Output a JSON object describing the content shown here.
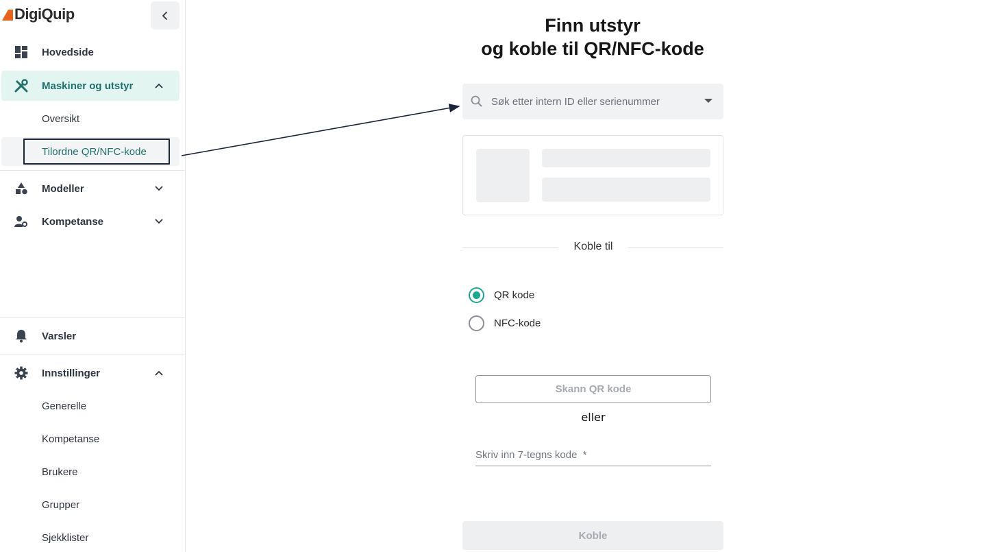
{
  "app": {
    "name": "DigiQuip",
    "brand_color": "#e8641e",
    "accent": "#1aa893"
  },
  "sidebar": {
    "collapse_icon": "chevron-left-icon",
    "nav": [
      {
        "label": "Hovedside",
        "icon": "dashboard-icon"
      },
      {
        "label": "Maskiner og utstyr",
        "icon": "tools-icon",
        "expanded": true,
        "children": [
          "Oversikt",
          "Tilordne QR/NFC-kode"
        ],
        "selected_child": "Tilordne QR/NFC-kode"
      },
      {
        "label": "Modeller",
        "icon": "shapes-icon",
        "expanded": false
      },
      {
        "label": "Kompetanse",
        "icon": "user-gear-icon",
        "expanded": false
      }
    ],
    "bottom": [
      {
        "label": "Varsler",
        "icon": "bell-icon"
      },
      {
        "label": "Innstillinger",
        "icon": "gear-icon",
        "expanded": true,
        "children": [
          "Generelle",
          "Kompetanse",
          "Brukere",
          "Grupper",
          "Sjekklister"
        ]
      }
    ]
  },
  "main": {
    "title_line1": "Finn utstyr",
    "title_line2": "og koble til QR/NFC-kode",
    "search": {
      "placeholder": "Søk etter intern ID eller serienummer"
    },
    "section_label": "Koble til",
    "options": [
      {
        "label": "QR kode",
        "checked": true
      },
      {
        "label": "NFC-kode",
        "checked": false
      }
    ],
    "scan_button": "Skann QR kode",
    "or_text": "eller",
    "code_input": {
      "placeholder": "Skriv inn 7-tegns kode  *"
    },
    "submit_button": "Koble"
  }
}
